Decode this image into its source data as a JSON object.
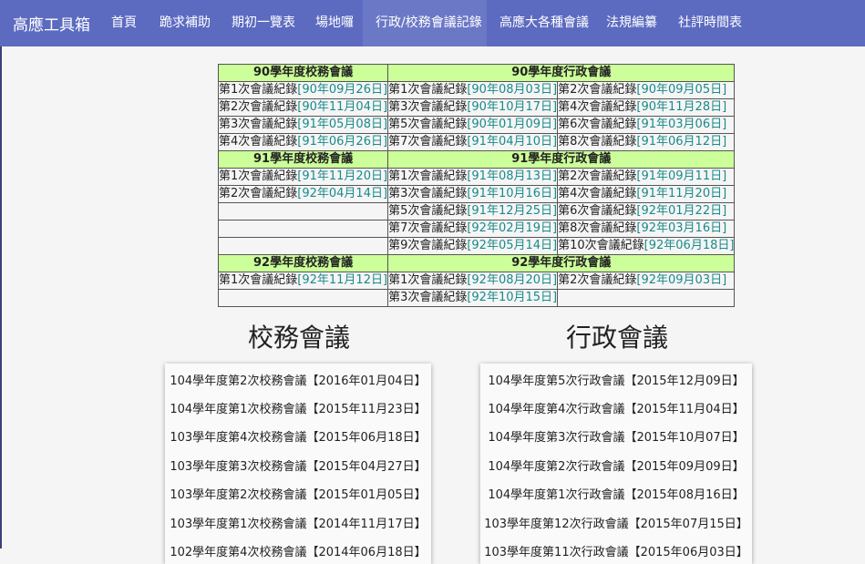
{
  "brand": "高應工具箱",
  "nav": [
    {
      "label": "首頁",
      "active": false
    },
    {
      "label": "跪求補助",
      "active": false
    },
    {
      "label": "期初一覽表",
      "active": false
    },
    {
      "label": "場地囉",
      "active": false
    },
    {
      "label": "行政/校務會議記錄",
      "active": true
    },
    {
      "label": "高應大各種會議",
      "active": false
    },
    {
      "label": "法規編纂",
      "active": false
    },
    {
      "label": "社評時間表",
      "active": false
    }
  ],
  "table": {
    "rows": [
      {
        "type": "header",
        "left": "90學年度校務會議",
        "right": "90學年度行政會議"
      },
      {
        "type": "row",
        "school": {
          "label": "第1次會議紀錄",
          "date": "[90年09月26日]"
        },
        "admin1": {
          "label": "第1次會議紀錄",
          "date": "[90年08月03日]"
        },
        "admin2": {
          "label": "第2次會議紀錄",
          "date": "[90年09月05日]"
        }
      },
      {
        "type": "row",
        "school": {
          "label": "第2次會議紀錄",
          "date": "[90年11月04日]"
        },
        "admin1": {
          "label": "第3次會議紀錄",
          "date": "[90年10月17日]"
        },
        "admin2": {
          "label": "第4次會議紀錄",
          "date": "[90年11月28日]"
        }
      },
      {
        "type": "row",
        "school": {
          "label": "第3次會議紀錄",
          "date": "[91年05月08日]"
        },
        "admin1": {
          "label": "第5次會議紀錄",
          "date": "[90年01月09日]"
        },
        "admin2": {
          "label": "第6次會議紀錄",
          "date": "[91年03月06日]"
        }
      },
      {
        "type": "row",
        "school": {
          "label": "第4次會議紀錄",
          "date": "[91年06月26日]"
        },
        "admin1": {
          "label": "第7次會議紀錄",
          "date": "[91年04月10日]"
        },
        "admin2": {
          "label": "第8次會議紀錄",
          "date": "[91年06月12日]"
        }
      },
      {
        "type": "header",
        "left": "91學年度校務會議",
        "right": "91學年度行政會議"
      },
      {
        "type": "row",
        "school": {
          "label": "第1次會議紀錄",
          "date": "[91年11月20日]"
        },
        "admin1": {
          "label": "第1次會議紀錄",
          "date": "[91年08月13日]"
        },
        "admin2": {
          "label": "第2次會議紀錄",
          "date": "[91年09月11日]"
        }
      },
      {
        "type": "row",
        "school": {
          "label": "第2次會議紀錄",
          "date": "[92年04月14日]"
        },
        "admin1": {
          "label": "第3次會議紀錄",
          "date": "[91年10月16日]"
        },
        "admin2": {
          "label": "第4次會議紀錄",
          "date": "[91年11月20日]"
        }
      },
      {
        "type": "row",
        "school": null,
        "admin1": {
          "label": "第5次會議紀錄",
          "date": "[91年12月25日]"
        },
        "admin2": {
          "label": "第6次會議紀錄",
          "date": "[92年01月22日]"
        }
      },
      {
        "type": "row",
        "school": null,
        "admin1": {
          "label": "第7次會議紀錄",
          "date": "[92年02月19日]"
        },
        "admin2": {
          "label": "第8次會議紀錄",
          "date": "[92年03月16日]"
        }
      },
      {
        "type": "row",
        "school": null,
        "admin1": {
          "label": "第9次會議紀錄",
          "date": "[92年05月14日]"
        },
        "admin2": {
          "label": "第10次會議紀錄",
          "date": "[92年06月18日]"
        }
      },
      {
        "type": "header",
        "left": "92學年度校務會議",
        "right": "92學年度行政會議"
      },
      {
        "type": "row",
        "school": {
          "label": "第1次會議紀錄",
          "date": "[92年11月12日]"
        },
        "admin1": {
          "label": "第1次會議紀錄",
          "date": "[92年08月20日]"
        },
        "admin2": {
          "label": "第2次會議紀錄",
          "date": "[92年09月03日]"
        }
      },
      {
        "type": "row",
        "school": null,
        "admin1": {
          "label": "第3次會議紀錄",
          "date": "[92年10月15日]"
        },
        "admin2": null
      }
    ]
  },
  "school_section": {
    "title": "校務會議",
    "items": [
      "104學年度第2次校務會議【2016年01月04日】",
      "104學年度第1次校務會議【2015年11月23日】",
      "103學年度第4次校務會議【2015年06月18日】",
      "103學年度第3次校務會議【2015年04月27日】",
      "103學年度第2次校務會議【2015年01月05日】",
      "103學年度第1次校務會議【2014年11月17日】",
      "102學年度第4次校務會議【2014年06月18日】"
    ]
  },
  "admin_section": {
    "title": "行政會議",
    "items": [
      "104學年度第5次行政會議【2015年12月09日】",
      "104學年度第4次行政會議【2015年11月04日】",
      "104學年度第3次行政會議【2015年10月07日】",
      "104學年度第2次行政會議【2015年09月09日】",
      "104學年度第1次行政會議【2015年08月16日】",
      "103學年度第12次行政會議【2015年07月15日】",
      "103學年度第11次行政會議【2015年06月03日】"
    ]
  }
}
